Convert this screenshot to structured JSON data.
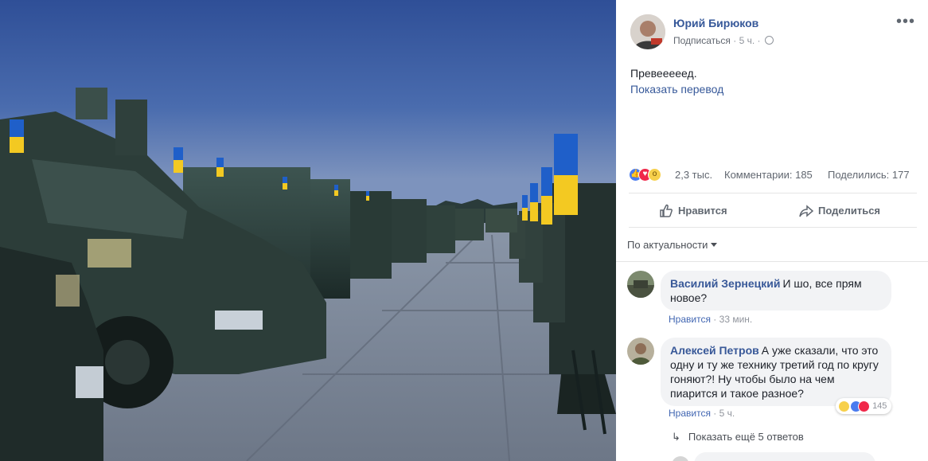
{
  "post": {
    "author": "Юрий Бирюков",
    "follow": "Подписаться",
    "separator": "·",
    "time": "5 ч.",
    "more": "•••",
    "text": "Превееееед.",
    "translate": "Показать перевод",
    "reactions_count": "2,3 тыс.",
    "comments": "Комментарии: 185",
    "shares": "Поделились: 177",
    "like_action": "Нравится",
    "share_action": "Поделиться"
  },
  "sort_label": "По актуальности",
  "comments": [
    {
      "name": "Василий Зернецкий",
      "text": "И шо, все прям новое?",
      "like": "Нравится",
      "time": "33 мин."
    },
    {
      "name": "Алексей Петров",
      "text": "А уже сказали, что это одну и ту же технику третий год по кругу гоняют?! Ну чтобы было на чем пиарится и такое разное?",
      "like": "Нравится",
      "time": "5 ч.",
      "reactions": "145"
    }
  ],
  "more_replies": "Показать ещё 5 ответов",
  "colors": {
    "link": "#365899",
    "sky": "#3c5fa6",
    "vehicle": "#2c3d39",
    "flag_blue": "#1f5fc9",
    "flag_yellow": "#f3c922"
  },
  "icons": [
    "globe-icon",
    "more-icon",
    "like-reaction-icon",
    "love-reaction-icon",
    "wow-reaction-icon",
    "thumbs-up-icon",
    "share-arrow-icon",
    "caret-down-icon",
    "reply-arrow-icon",
    "haha-reaction-icon"
  ]
}
